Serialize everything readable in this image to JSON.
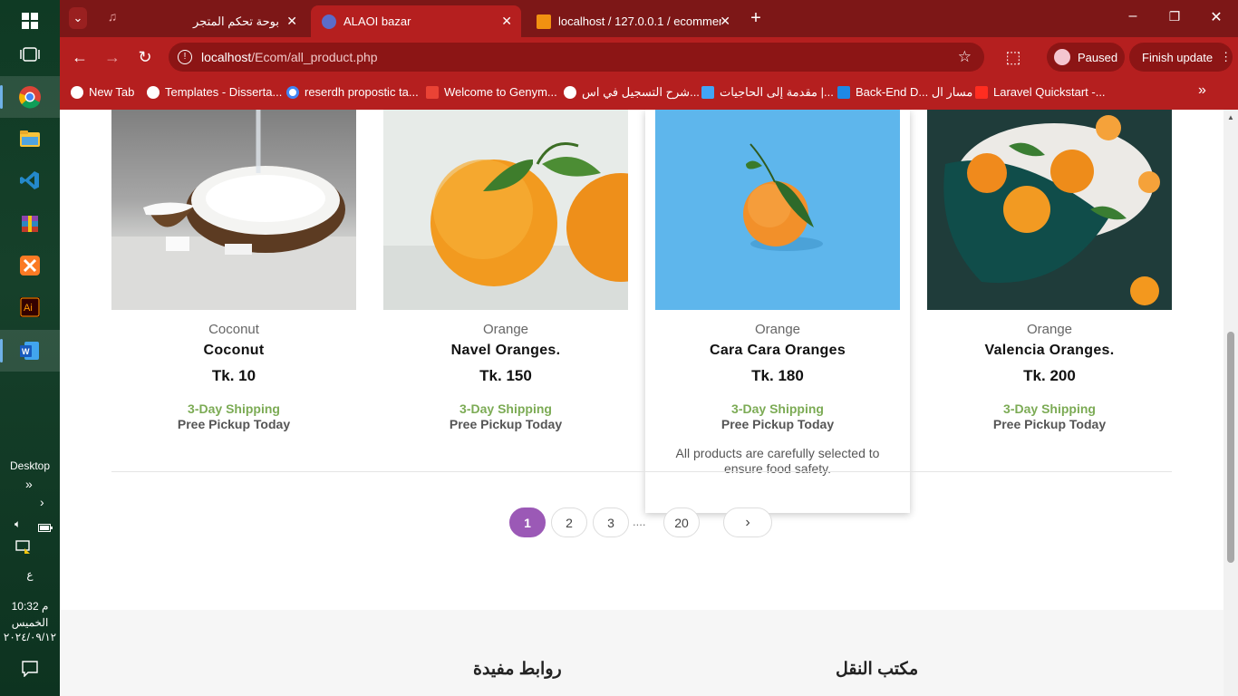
{
  "taskbar": {
    "desktop_label": "Desktop",
    "time": "10:32 م",
    "day": "الخميس",
    "date": "٢٠٢٤/٠٩/١٢",
    "lang": "ع"
  },
  "tabs": [
    {
      "title": "بوحة تحكم المتجر",
      "active": false
    },
    {
      "title": "ALAOI bazar",
      "active": true
    },
    {
      "title": "localhost / 127.0.0.1 / ecommer",
      "active": false
    }
  ],
  "address": {
    "host": "localhost",
    "path": "/Ecom/all_product.php"
  },
  "profile": {
    "status": "Paused",
    "finish_update": "Finish update"
  },
  "bookmarks": [
    {
      "label": "New Tab",
      "color": "#ffffff"
    },
    {
      "label": "Templates - Disserta...",
      "color": "#ffffff"
    },
    {
      "label": "reserdh propostic ta...",
      "color": "#4285f4"
    },
    {
      "label": "Welcome to Genym...",
      "color": "#ea4335"
    },
    {
      "label": "شرح التسجيل في اس...",
      "color": "#ffffff"
    },
    {
      "label": "مقدمة إلى الحاجيات |...",
      "color": "#42a5f5"
    },
    {
      "label": "Back-End D... مسار ال",
      "color": "#1e88e5"
    },
    {
      "label": "Laravel Quickstart -...",
      "color": "#ff2d20"
    }
  ],
  "products": [
    {
      "category": "Coconut",
      "name": "Coconut",
      "price": "Tk. 10",
      "shipping": "3-Day Shipping",
      "pickup": "Pree Pickup Today",
      "image": "coconut"
    },
    {
      "category": "Orange",
      "name": "Navel Oranges.",
      "price": "Tk. 150",
      "shipping": "3-Day Shipping",
      "pickup": "Pree Pickup Today",
      "image": "two-oranges"
    },
    {
      "category": "Orange",
      "name": "Cara Cara Oranges",
      "price": "Tk. 180",
      "shipping": "3-Day Shipping",
      "pickup": "Pree Pickup Today",
      "image": "orange-blue",
      "description": "All products are carefully selected to ensure food safety."
    },
    {
      "category": "Orange",
      "name": "Valencia Oranges.",
      "price": "Tk. 200",
      "shipping": "3-Day Shipping",
      "pickup": "Pree Pickup Today",
      "image": "oranges-bowl"
    }
  ],
  "pagination": {
    "pages": [
      "1",
      "2",
      "3",
      "20"
    ],
    "dots": "....",
    "current": "1",
    "next_icon": "chevron-right-icon"
  },
  "footer": {
    "useful_links": "روابط مفيدة",
    "shipping_office": "مكتب النقل"
  },
  "colors": {
    "accent": "#9b59b6",
    "shipping": "#7cab55",
    "browser": "#b51f1f"
  }
}
